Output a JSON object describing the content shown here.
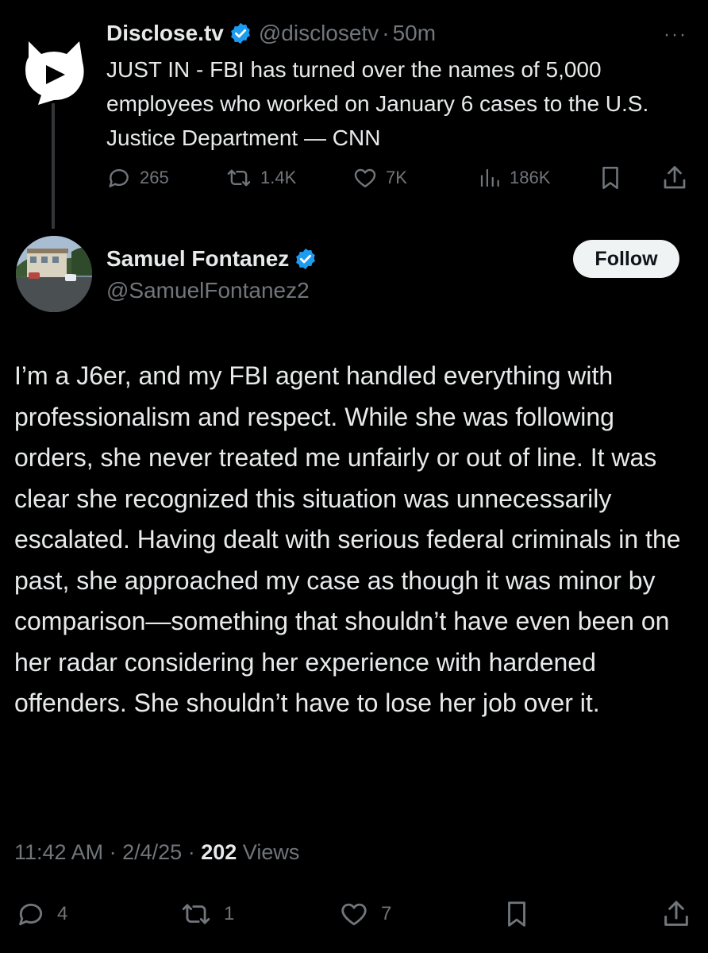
{
  "parent": {
    "name": "Disclose.tv",
    "handle": "@disclosetv",
    "separator": "·",
    "time": "50m",
    "more": "···",
    "text": "JUST IN - FBI has turned over the names of 5,000 employees who worked on January 6 cases to the U.S. Justice Department — CNN",
    "stats": {
      "replies": "265",
      "reposts": "1.4K",
      "likes": "7K",
      "views": "186K"
    }
  },
  "reply": {
    "name": "Samuel Fontanez",
    "handle": "@SamuelFontanez2",
    "follow_label": "Follow",
    "text": "I’m a J6er, and my FBI agent handled everything with professionalism and respect. While she was following orders, she never treated me unfairly or out of line. It was clear she recognized this situation was unnecessarily escalated. Having dealt with serious federal criminals in the past, she approached my case as though it was minor by comparison—something that shouldn’t have even been on her radar considering her experience with hardened offenders. She shouldn’t have to lose her job over it.",
    "time": "11:42 AM",
    "date": "2/4/25",
    "separator": "·",
    "views_count": "202",
    "views_label": "Views",
    "stats": {
      "replies": "4",
      "reposts": "1",
      "likes": "7"
    }
  },
  "colors": {
    "background": "#000000",
    "text": "#e7e9ea",
    "muted": "#71767b",
    "verified": "#1d9bf0",
    "follow_bg": "#eff3f4"
  },
  "icons": [
    "disclose-logo-icon",
    "verified-badge-icon",
    "more-icon",
    "reply-icon",
    "repost-icon",
    "like-icon",
    "views-icon",
    "bookmark-icon",
    "share-icon"
  ]
}
